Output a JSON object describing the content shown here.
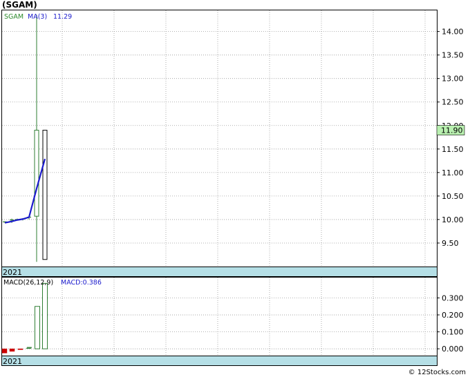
{
  "header": {
    "title": "(SGAM)"
  },
  "footer": {
    "credit": "© 12Stocks.com"
  },
  "colors": {
    "grid": "#999999",
    "bull": "#2e7d32",
    "bear": "#000000",
    "ma_line": "#1a1acc",
    "ticker_label": "#2e8b2e",
    "ma_label": "#1a1acc",
    "price_box_bg": "#b9f0b0",
    "year_band": "#b5dfe6",
    "macd_neg": "#cc0000",
    "macd_pos": "#2e7d32"
  },
  "chart_data": [
    {
      "type": "candlestick",
      "legend": {
        "ticker": "SGAM",
        "ma_label": "MA(3)",
        "ma_value": "11.29"
      },
      "x_label": "2021",
      "ylim": [
        9.0,
        14.45
      ],
      "y_ticks": [
        9.5,
        10.0,
        10.5,
        11.0,
        11.5,
        12.0,
        12.5,
        13.0,
        13.5,
        14.0
      ],
      "y_tick_labels": [
        "9.50",
        "10.00",
        "10.50",
        "11.00",
        "11.50",
        "12.00",
        "12.50",
        "13.00",
        "13.50",
        "14.00"
      ],
      "last_price": 11.9,
      "last_price_label": "11.90",
      "candles": [
        {
          "open": 9.95,
          "high": 9.96,
          "low": 9.93,
          "close": 9.95
        },
        {
          "open": 9.97,
          "high": 10.02,
          "low": 9.93,
          "close": 9.99
        },
        {
          "open": 10.0,
          "high": 10.02,
          "low": 9.98,
          "close": 10.0
        },
        {
          "open": 10.02,
          "high": 10.03,
          "low": 9.98,
          "close": 10.01
        },
        {
          "open": 10.04,
          "high": 10.08,
          "low": 10.0,
          "close": 10.05
        },
        {
          "open": 10.07,
          "high": 14.35,
          "low": 9.1,
          "close": 11.9
        },
        {
          "open": 11.9,
          "high": 11.9,
          "low": 9.15,
          "close": 9.15
        }
      ],
      "ma": [
        9.93,
        9.96,
        9.99,
        10.01,
        10.05,
        10.66,
        11.29
      ]
    },
    {
      "type": "bar",
      "legend": {
        "label": "MACD(26,12,9)",
        "value_label": "MACD:0.386"
      },
      "x_label": "2021",
      "ylim": [
        -0.04,
        0.42
      ],
      "y_ticks": [
        0.0,
        0.1,
        0.2,
        0.3
      ],
      "y_tick_labels": [
        "0.000",
        "0.100",
        "0.200",
        "0.300"
      ],
      "values": [
        -0.025,
        -0.015,
        -0.005,
        0.003,
        0.008,
        0.25,
        0.386
      ]
    }
  ]
}
